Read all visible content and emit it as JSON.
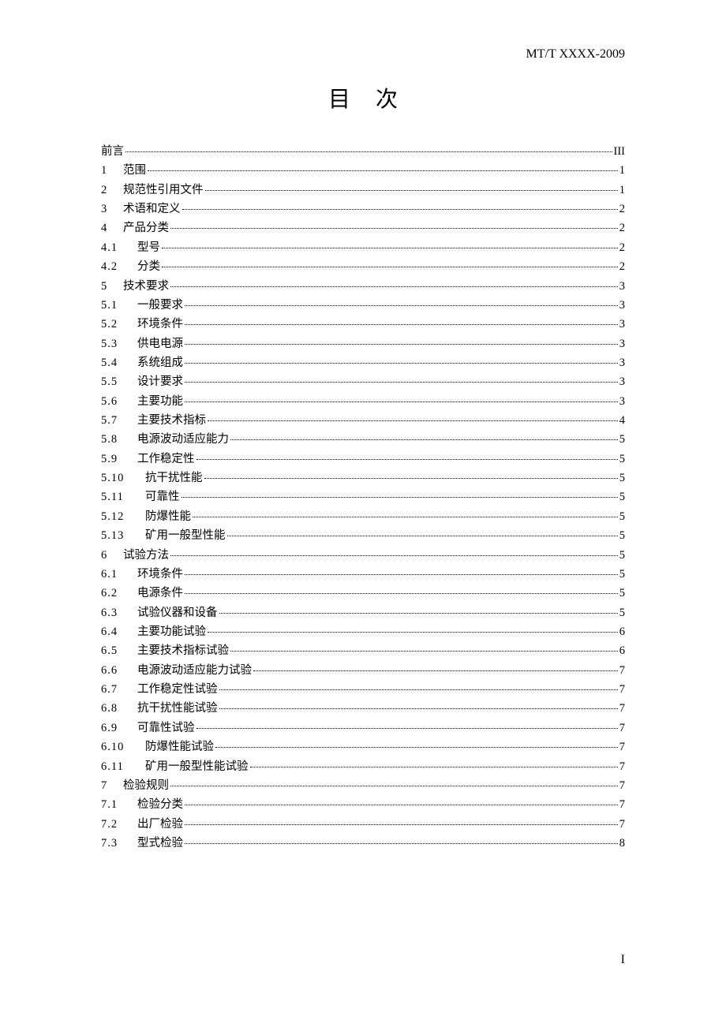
{
  "doc_id": "MT/T XXXX-2009",
  "title": "目次",
  "footer_page": "I",
  "toc": [
    {
      "num": "",
      "label": "前言",
      "page": "III",
      "indent": "l0"
    },
    {
      "num": "1",
      "label": "范围",
      "page": "1",
      "indent": "l1"
    },
    {
      "num": "2",
      "label": "规范性引用文件",
      "page": "1",
      "indent": "l1"
    },
    {
      "num": "3",
      "label": "术语和定义",
      "page": "2",
      "indent": "l1"
    },
    {
      "num": "4",
      "label": "产品分类",
      "page": "2",
      "indent": "l1"
    },
    {
      "num": "4.1",
      "label": "型号",
      "page": "2",
      "indent": "l2"
    },
    {
      "num": "4.2",
      "label": "分类",
      "page": "2",
      "indent": "l2"
    },
    {
      "num": "5",
      "label": "技术要求",
      "page": "3",
      "indent": "l1"
    },
    {
      "num": "5.1",
      "label": "一般要求",
      "page": "3",
      "indent": "l2"
    },
    {
      "num": "5.2",
      "label": "环境条件",
      "page": "3",
      "indent": "l2"
    },
    {
      "num": "5.3",
      "label": "供电电源",
      "page": "3",
      "indent": "l2"
    },
    {
      "num": "5.4",
      "label": "系统组成",
      "page": "3",
      "indent": "l2"
    },
    {
      "num": "5.5",
      "label": "设计要求",
      "page": "3",
      "indent": "l2"
    },
    {
      "num": "5.6",
      "label": "主要功能",
      "page": "3",
      "indent": "l2"
    },
    {
      "num": "5.7",
      "label": "主要技术指标",
      "page": "4",
      "indent": "l2"
    },
    {
      "num": "5.8",
      "label": "电源波动适应能力",
      "page": "5",
      "indent": "l2"
    },
    {
      "num": "5.9",
      "label": "工作稳定性",
      "page": "5",
      "indent": "l2"
    },
    {
      "num": "5.10",
      "label": "抗干扰性能",
      "page": "5",
      "indent": "l2"
    },
    {
      "num": "5.11",
      "label": "可靠性",
      "page": "5",
      "indent": "l2"
    },
    {
      "num": "5.12",
      "label": "防爆性能",
      "page": "5",
      "indent": "l2"
    },
    {
      "num": "5.13",
      "label": "矿用一般型性能",
      "page": "5",
      "indent": "l2"
    },
    {
      "num": "6",
      "label": "试验方法",
      "page": "5",
      "indent": "l1"
    },
    {
      "num": "6.1",
      "label": "环境条件",
      "page": "5",
      "indent": "l2"
    },
    {
      "num": "6.2",
      "label": "电源条件",
      "page": "5",
      "indent": "l2"
    },
    {
      "num": "6.3",
      "label": "试验仪器和设备",
      "page": "5",
      "indent": "l2"
    },
    {
      "num": "6.4",
      "label": "主要功能试验",
      "page": "6",
      "indent": "l2"
    },
    {
      "num": "6.5",
      "label": "主要技术指标试验",
      "page": "6",
      "indent": "l2"
    },
    {
      "num": "6.6",
      "label": "电源波动适应能力试验",
      "page": "7",
      "indent": "l2"
    },
    {
      "num": "6.7",
      "label": "工作稳定性试验",
      "page": "7",
      "indent": "l2"
    },
    {
      "num": "6.8",
      "label": "抗干扰性能试验",
      "page": "7",
      "indent": "l2"
    },
    {
      "num": "6.9",
      "label": "可靠性试验",
      "page": "7",
      "indent": "l2"
    },
    {
      "num": "6.10",
      "label": "防爆性能试验",
      "page": "7",
      "indent": "l2"
    },
    {
      "num": "6.11",
      "label": "矿用一般型性能试验",
      "page": "7",
      "indent": "l2"
    },
    {
      "num": "7",
      "label": "检验规则",
      "page": "7",
      "indent": "l1"
    },
    {
      "num": "7.1",
      "label": "检验分类",
      "page": "7",
      "indent": "l2"
    },
    {
      "num": "7.2",
      "label": "出厂检验",
      "page": "7",
      "indent": "l2"
    },
    {
      "num": "7.3",
      "label": "型式检验",
      "page": "8",
      "indent": "l2"
    }
  ]
}
